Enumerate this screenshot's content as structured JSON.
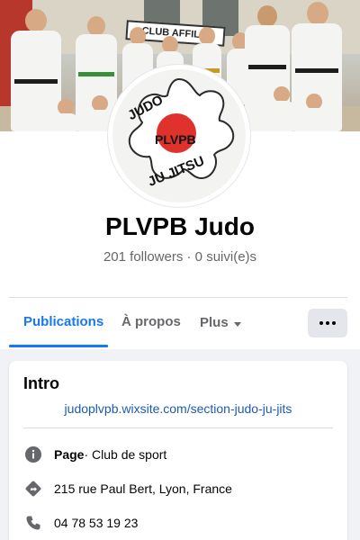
{
  "cover": {
    "sign_text": "CLUB AFFILIÉ"
  },
  "avatar": {
    "logo_top": "JUDO",
    "logo_mid": "PLVPB",
    "logo_bottom": "JU JITSU"
  },
  "page": {
    "name": "PLVPB Judo",
    "followers": "201 followers · 0 suivi(e)s"
  },
  "tabs": {
    "items": [
      {
        "label": "Publications",
        "active": true
      },
      {
        "label": "À propos",
        "active": false
      },
      {
        "label": "Plus",
        "active": false
      }
    ],
    "more_icon": "ellipsis-icon"
  },
  "intro": {
    "title": "Intro",
    "link": "judoplvpb.wixsite.com/section-judo-ju-jits",
    "category_label": "Page",
    "category_value": " · Club de sport",
    "address": "215 rue Paul Bert, Lyon, France",
    "phone": "04 78 53 19 23"
  },
  "colors": {
    "accent": "#1877f2",
    "link": "#1c5bb0",
    "muted": "#65676b",
    "background": "#f0f2f5"
  },
  "icons": [
    "info-icon",
    "directions-icon",
    "phone-icon",
    "caret-down-icon"
  ]
}
